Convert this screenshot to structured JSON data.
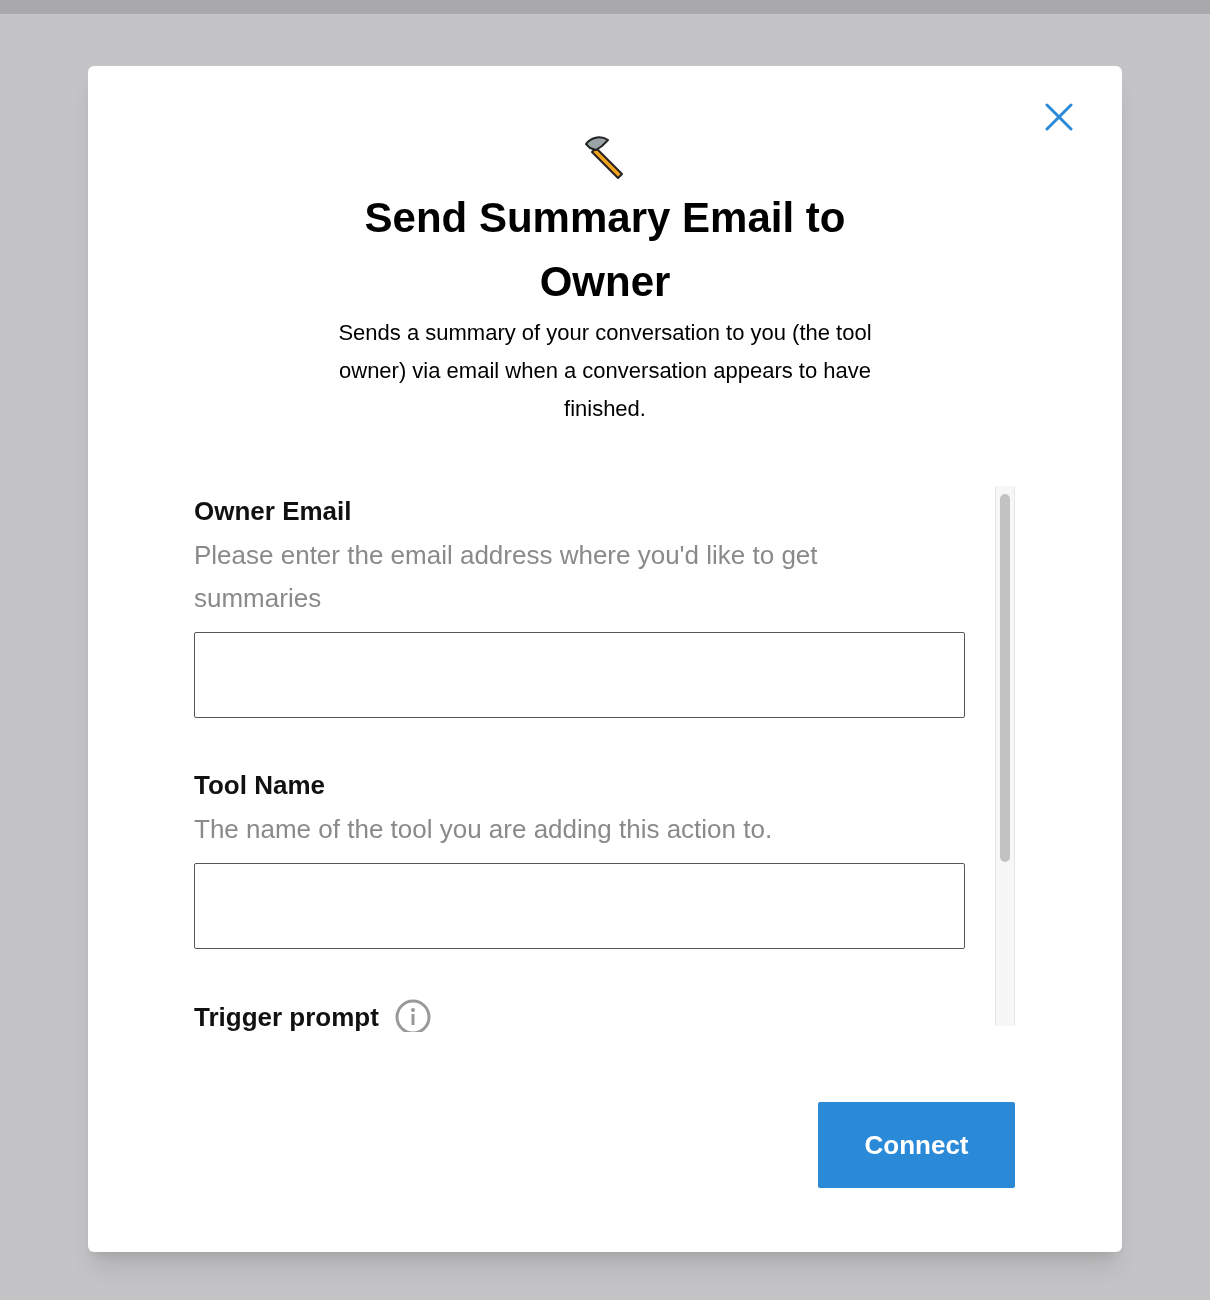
{
  "dialog": {
    "title": "Send Summary Email to Owner",
    "description": "Sends a summary of your conversation to you (the tool owner) via email when a conversation appears to have finished.",
    "fields": [
      {
        "kind": "input",
        "label": "Owner Email",
        "help": "Please enter the email address where you'd like to get summaries"
      },
      {
        "kind": "input",
        "label": "Tool Name",
        "help": "The name of the tool you are adding this action to."
      },
      {
        "kind": "info",
        "label": "Trigger prompt"
      }
    ],
    "primary_button": "Connect"
  }
}
